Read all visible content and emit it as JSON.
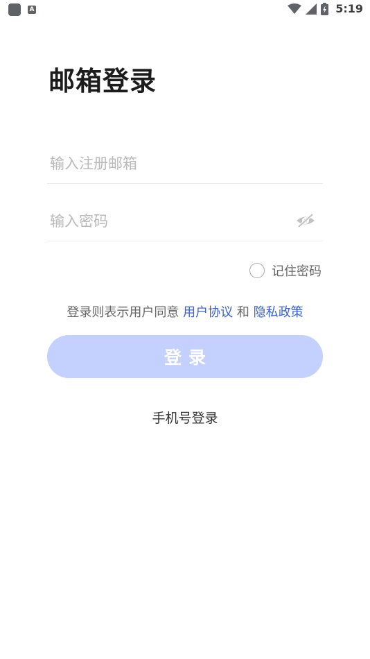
{
  "status_bar": {
    "notification_badge": "A",
    "time": "5:19"
  },
  "page": {
    "title": "邮箱登录"
  },
  "email": {
    "placeholder": "输入注册邮箱",
    "value": ""
  },
  "password": {
    "placeholder": "输入密码",
    "value": "",
    "toggle_icon": "eye-hidden-icon"
  },
  "remember": {
    "label": "记住密码",
    "checked": false
  },
  "agreement": {
    "prefix": "登录则表示用户同意",
    "user_agreement": "用户协议",
    "and": "和",
    "privacy_policy": "隐私政策"
  },
  "login_button": {
    "label": "登录"
  },
  "phone_login": {
    "label": "手机号登录"
  },
  "colors": {
    "accent_link": "#3a62d8",
    "button_bg_disabled": "#c4d0fd"
  }
}
